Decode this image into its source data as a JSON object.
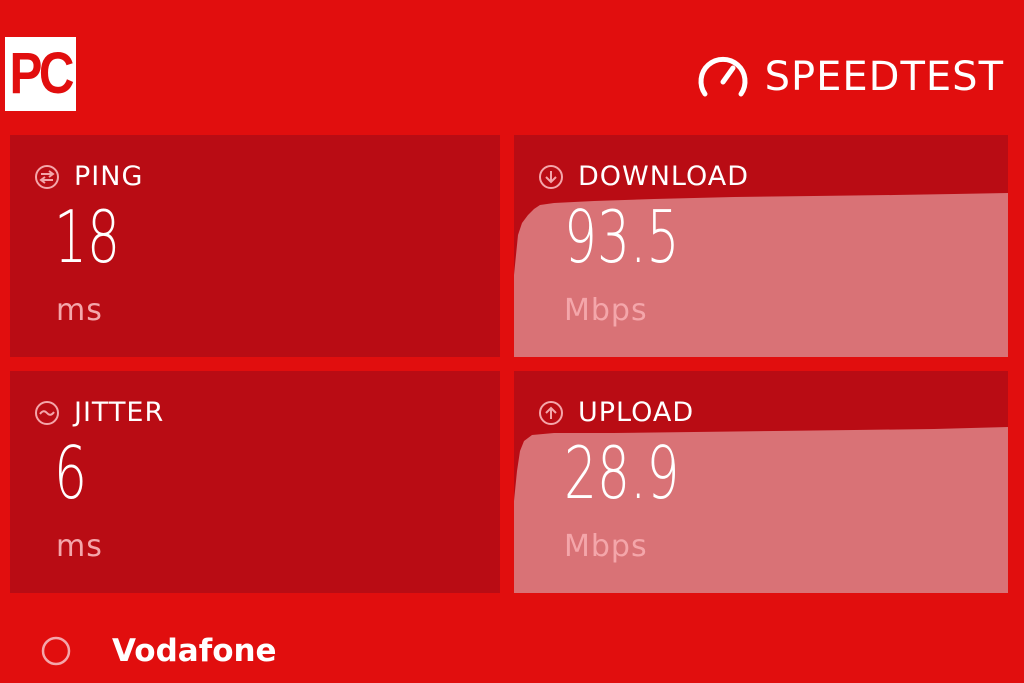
{
  "header": {
    "logo_text": "PC",
    "brand_name": "SPEEDTEST",
    "brand_icon": "gauge-icon"
  },
  "metrics": {
    "ping": {
      "label": "PING",
      "value": "18",
      "unit": "ms",
      "icon": "ping-icon"
    },
    "download": {
      "label": "DOWNLOAD",
      "value": "93.5",
      "unit": "Mbps",
      "icon": "arrow-down-circle-icon"
    },
    "jitter": {
      "label": "JITTER",
      "value": "6",
      "unit": "ms",
      "icon": "jitter-icon"
    },
    "upload": {
      "label": "UPLOAD",
      "value": "28.9",
      "unit": "Mbps",
      "icon": "arrow-up-circle-icon"
    }
  },
  "provider": {
    "name": "Vodafone",
    "icon": "provider-circle-icon"
  },
  "colors": {
    "background": "#e10e0e",
    "tile": "#b90c14",
    "graph_fill": "#d97276",
    "unit_text": "#f4a6aa"
  }
}
